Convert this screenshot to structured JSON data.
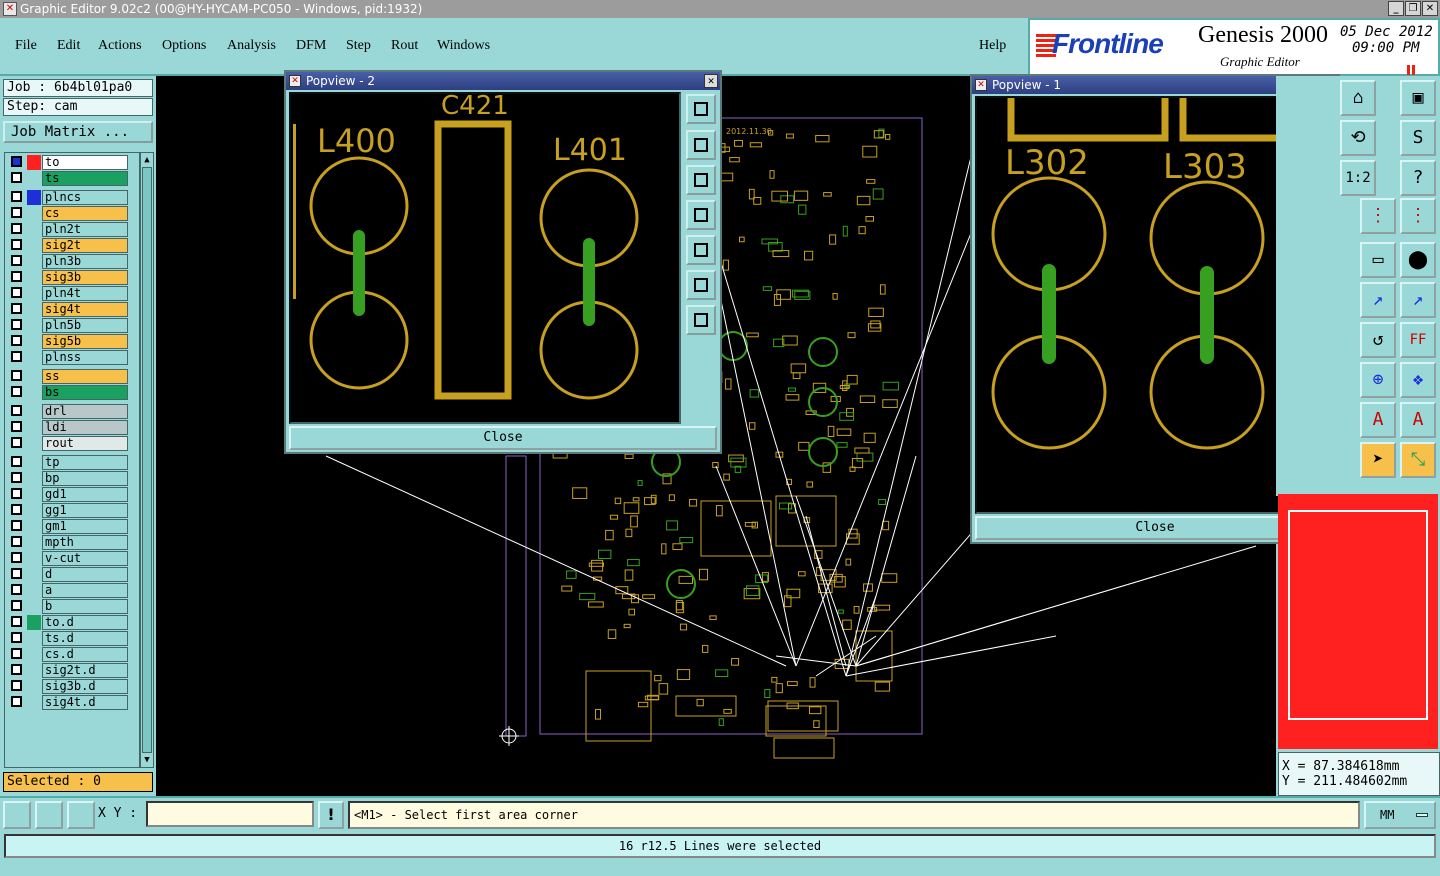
{
  "window": {
    "title": "Graphic Editor 9.02c2 (00@HY-HYCAM-PC050 - Windows, pid:1932)",
    "app_icon": "genesis-x-icon",
    "controls": [
      "minimize-icon",
      "restore-icon",
      "close-icon"
    ]
  },
  "menu": {
    "items": [
      {
        "label": "File",
        "key": "F"
      },
      {
        "label": "Edit",
        "key": "E"
      },
      {
        "label": "Actions",
        "key": "A"
      },
      {
        "label": "Options",
        "key": "O"
      },
      {
        "label": "Analysis",
        "key": "A"
      },
      {
        "label": "DFM",
        "key": "D"
      },
      {
        "label": "Step",
        "key": "S"
      },
      {
        "label": "Rout",
        "key": "R"
      },
      {
        "label": "Windows",
        "key": "W"
      }
    ],
    "help": "Help"
  },
  "brand": {
    "logo": "Frontline",
    "product": "Genesis 2000",
    "subtitle": "Graphic Editor",
    "date": "05 Dec 2012",
    "time": "09:00 PM"
  },
  "job": {
    "job_label": "Job : 6b4bl01pa0",
    "step_label": "Step: cam",
    "matrix_button": "Job Matrix ..."
  },
  "layers": [
    {
      "name": "to",
      "color": "#ffffff",
      "swatch": "#ff2020",
      "selected": true
    },
    {
      "name": "ts",
      "color": "#1aa060",
      "swatch": "",
      "selected": false
    },
    {
      "name": "plncs",
      "color": "#9ad8d8",
      "swatch": "#1c2fd8",
      "selected": false
    },
    {
      "name": "cs",
      "color": "#f6c04a",
      "swatch": "",
      "selected": false
    },
    {
      "name": "pln2t",
      "color": "#9ad8d8",
      "swatch": "",
      "selected": false
    },
    {
      "name": "sig2t",
      "color": "#f6c04a",
      "swatch": "",
      "selected": false
    },
    {
      "name": "pln3b",
      "color": "#9ad8d8",
      "swatch": "",
      "selected": false
    },
    {
      "name": "sig3b",
      "color": "#f6c04a",
      "swatch": "",
      "selected": false
    },
    {
      "name": "pln4t",
      "color": "#9ad8d8",
      "swatch": "",
      "selected": false
    },
    {
      "name": "sig4t",
      "color": "#f6c04a",
      "swatch": "",
      "selected": false
    },
    {
      "name": "pln5b",
      "color": "#9ad8d8",
      "swatch": "",
      "selected": false
    },
    {
      "name": "sig5b",
      "color": "#f6c04a",
      "swatch": "",
      "selected": false
    },
    {
      "name": "plnss",
      "color": "#9ad8d8",
      "swatch": "",
      "selected": false
    },
    {
      "name": "ss",
      "color": "#f6c04a",
      "swatch": "",
      "selected": false
    },
    {
      "name": "bs",
      "color": "#1aa060",
      "swatch": "",
      "selected": false
    },
    {
      "name": "drl",
      "color": "#b8c8c8",
      "swatch": "",
      "selected": false
    },
    {
      "name": "ldi",
      "color": "#b8c8c8",
      "swatch": "",
      "selected": false
    },
    {
      "name": "rout",
      "color": "#e0e8e8",
      "swatch": "",
      "selected": false
    },
    {
      "name": "tp",
      "color": "#9ad8d8",
      "swatch": "",
      "selected": false
    },
    {
      "name": "bp",
      "color": "#9ad8d8",
      "swatch": "",
      "selected": false
    },
    {
      "name": "gd1",
      "color": "#9ad8d8",
      "swatch": "",
      "selected": false
    },
    {
      "name": "gg1",
      "color": "#9ad8d8",
      "swatch": "",
      "selected": false
    },
    {
      "name": "gm1",
      "color": "#9ad8d8",
      "swatch": "",
      "selected": false
    },
    {
      "name": "mpth",
      "color": "#9ad8d8",
      "swatch": "",
      "selected": false
    },
    {
      "name": "v-cut",
      "color": "#9ad8d8",
      "swatch": "",
      "selected": false
    },
    {
      "name": "d",
      "color": "#9ad8d8",
      "swatch": "",
      "selected": false
    },
    {
      "name": "a",
      "color": "#9ad8d8",
      "swatch": "",
      "selected": false
    },
    {
      "name": "b",
      "color": "#9ad8d8",
      "swatch": "",
      "selected": false
    },
    {
      "name": "to.d",
      "color": "#9ad8d8",
      "swatch": "#1aa060",
      "selected": false
    },
    {
      "name": "ts.d",
      "color": "#9ad8d8",
      "swatch": "",
      "selected": false
    },
    {
      "name": "cs.d",
      "color": "#9ad8d8",
      "swatch": "",
      "selected": false
    },
    {
      "name": "sig2t.d",
      "color": "#9ad8d8",
      "swatch": "",
      "selected": false
    },
    {
      "name": "sig3b.d",
      "color": "#9ad8d8",
      "swatch": "",
      "selected": false
    },
    {
      "name": "sig4t.d",
      "color": "#9ad8d8",
      "swatch": "",
      "selected": false
    }
  ],
  "selected_label": "Selected : 0",
  "board": {
    "date_text": "2012.11.30"
  },
  "popview2": {
    "title": "Popview - 2",
    "labels": [
      "L400",
      "C421",
      "L401"
    ],
    "close_label": "Close"
  },
  "popview1": {
    "title": "Popview - 1",
    "labels": [
      "L302",
      "L303"
    ],
    "close_label": "Close"
  },
  "right_tools": {
    "ratio_label": "1:2",
    "help_glyph": "?",
    "ff_label": "FF"
  },
  "coords": {
    "x": "X = 87.384618mm",
    "y": "Y = 211.484602mm"
  },
  "bottom": {
    "xy_label": "X Y :",
    "xy_value": "",
    "warn": "!",
    "prompt": "<M1> - Select first area corner",
    "units": "MM"
  },
  "status": "16 r12.5 Lines were selected",
  "colors": {
    "accent": "#9ad8d8",
    "pad": "#c8a020",
    "trace": "#38a020",
    "selection": "#ffffff"
  }
}
